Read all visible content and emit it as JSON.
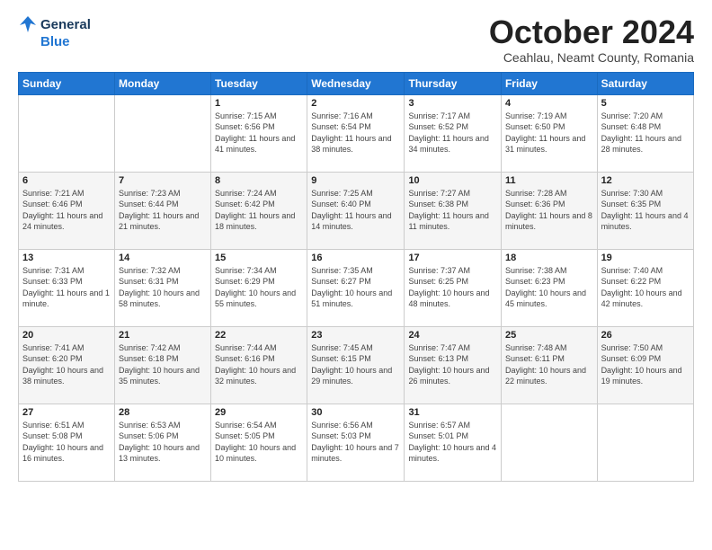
{
  "header": {
    "logo_general": "General",
    "logo_blue": "Blue",
    "month_title": "October 2024",
    "subtitle": "Ceahlau, Neamt County, Romania"
  },
  "days_of_week": [
    "Sunday",
    "Monday",
    "Tuesday",
    "Wednesday",
    "Thursday",
    "Friday",
    "Saturday"
  ],
  "weeks": [
    [
      {
        "num": "",
        "sunrise": "",
        "sunset": "",
        "daylight": ""
      },
      {
        "num": "",
        "sunrise": "",
        "sunset": "",
        "daylight": ""
      },
      {
        "num": "1",
        "sunrise": "Sunrise: 7:15 AM",
        "sunset": "Sunset: 6:56 PM",
        "daylight": "Daylight: 11 hours and 41 minutes."
      },
      {
        "num": "2",
        "sunrise": "Sunrise: 7:16 AM",
        "sunset": "Sunset: 6:54 PM",
        "daylight": "Daylight: 11 hours and 38 minutes."
      },
      {
        "num": "3",
        "sunrise": "Sunrise: 7:17 AM",
        "sunset": "Sunset: 6:52 PM",
        "daylight": "Daylight: 11 hours and 34 minutes."
      },
      {
        "num": "4",
        "sunrise": "Sunrise: 7:19 AM",
        "sunset": "Sunset: 6:50 PM",
        "daylight": "Daylight: 11 hours and 31 minutes."
      },
      {
        "num": "5",
        "sunrise": "Sunrise: 7:20 AM",
        "sunset": "Sunset: 6:48 PM",
        "daylight": "Daylight: 11 hours and 28 minutes."
      }
    ],
    [
      {
        "num": "6",
        "sunrise": "Sunrise: 7:21 AM",
        "sunset": "Sunset: 6:46 PM",
        "daylight": "Daylight: 11 hours and 24 minutes."
      },
      {
        "num": "7",
        "sunrise": "Sunrise: 7:23 AM",
        "sunset": "Sunset: 6:44 PM",
        "daylight": "Daylight: 11 hours and 21 minutes."
      },
      {
        "num": "8",
        "sunrise": "Sunrise: 7:24 AM",
        "sunset": "Sunset: 6:42 PM",
        "daylight": "Daylight: 11 hours and 18 minutes."
      },
      {
        "num": "9",
        "sunrise": "Sunrise: 7:25 AM",
        "sunset": "Sunset: 6:40 PM",
        "daylight": "Daylight: 11 hours and 14 minutes."
      },
      {
        "num": "10",
        "sunrise": "Sunrise: 7:27 AM",
        "sunset": "Sunset: 6:38 PM",
        "daylight": "Daylight: 11 hours and 11 minutes."
      },
      {
        "num": "11",
        "sunrise": "Sunrise: 7:28 AM",
        "sunset": "Sunset: 6:36 PM",
        "daylight": "Daylight: 11 hours and 8 minutes."
      },
      {
        "num": "12",
        "sunrise": "Sunrise: 7:30 AM",
        "sunset": "Sunset: 6:35 PM",
        "daylight": "Daylight: 11 hours and 4 minutes."
      }
    ],
    [
      {
        "num": "13",
        "sunrise": "Sunrise: 7:31 AM",
        "sunset": "Sunset: 6:33 PM",
        "daylight": "Daylight: 11 hours and 1 minute."
      },
      {
        "num": "14",
        "sunrise": "Sunrise: 7:32 AM",
        "sunset": "Sunset: 6:31 PM",
        "daylight": "Daylight: 10 hours and 58 minutes."
      },
      {
        "num": "15",
        "sunrise": "Sunrise: 7:34 AM",
        "sunset": "Sunset: 6:29 PM",
        "daylight": "Daylight: 10 hours and 55 minutes."
      },
      {
        "num": "16",
        "sunrise": "Sunrise: 7:35 AM",
        "sunset": "Sunset: 6:27 PM",
        "daylight": "Daylight: 10 hours and 51 minutes."
      },
      {
        "num": "17",
        "sunrise": "Sunrise: 7:37 AM",
        "sunset": "Sunset: 6:25 PM",
        "daylight": "Daylight: 10 hours and 48 minutes."
      },
      {
        "num": "18",
        "sunrise": "Sunrise: 7:38 AM",
        "sunset": "Sunset: 6:23 PM",
        "daylight": "Daylight: 10 hours and 45 minutes."
      },
      {
        "num": "19",
        "sunrise": "Sunrise: 7:40 AM",
        "sunset": "Sunset: 6:22 PM",
        "daylight": "Daylight: 10 hours and 42 minutes."
      }
    ],
    [
      {
        "num": "20",
        "sunrise": "Sunrise: 7:41 AM",
        "sunset": "Sunset: 6:20 PM",
        "daylight": "Daylight: 10 hours and 38 minutes."
      },
      {
        "num": "21",
        "sunrise": "Sunrise: 7:42 AM",
        "sunset": "Sunset: 6:18 PM",
        "daylight": "Daylight: 10 hours and 35 minutes."
      },
      {
        "num": "22",
        "sunrise": "Sunrise: 7:44 AM",
        "sunset": "Sunset: 6:16 PM",
        "daylight": "Daylight: 10 hours and 32 minutes."
      },
      {
        "num": "23",
        "sunrise": "Sunrise: 7:45 AM",
        "sunset": "Sunset: 6:15 PM",
        "daylight": "Daylight: 10 hours and 29 minutes."
      },
      {
        "num": "24",
        "sunrise": "Sunrise: 7:47 AM",
        "sunset": "Sunset: 6:13 PM",
        "daylight": "Daylight: 10 hours and 26 minutes."
      },
      {
        "num": "25",
        "sunrise": "Sunrise: 7:48 AM",
        "sunset": "Sunset: 6:11 PM",
        "daylight": "Daylight: 10 hours and 22 minutes."
      },
      {
        "num": "26",
        "sunrise": "Sunrise: 7:50 AM",
        "sunset": "Sunset: 6:09 PM",
        "daylight": "Daylight: 10 hours and 19 minutes."
      }
    ],
    [
      {
        "num": "27",
        "sunrise": "Sunrise: 6:51 AM",
        "sunset": "Sunset: 5:08 PM",
        "daylight": "Daylight: 10 hours and 16 minutes."
      },
      {
        "num": "28",
        "sunrise": "Sunrise: 6:53 AM",
        "sunset": "Sunset: 5:06 PM",
        "daylight": "Daylight: 10 hours and 13 minutes."
      },
      {
        "num": "29",
        "sunrise": "Sunrise: 6:54 AM",
        "sunset": "Sunset: 5:05 PM",
        "daylight": "Daylight: 10 hours and 10 minutes."
      },
      {
        "num": "30",
        "sunrise": "Sunrise: 6:56 AM",
        "sunset": "Sunset: 5:03 PM",
        "daylight": "Daylight: 10 hours and 7 minutes."
      },
      {
        "num": "31",
        "sunrise": "Sunrise: 6:57 AM",
        "sunset": "Sunset: 5:01 PM",
        "daylight": "Daylight: 10 hours and 4 minutes."
      },
      {
        "num": "",
        "sunrise": "",
        "sunset": "",
        "daylight": ""
      },
      {
        "num": "",
        "sunrise": "",
        "sunset": "",
        "daylight": ""
      }
    ]
  ]
}
